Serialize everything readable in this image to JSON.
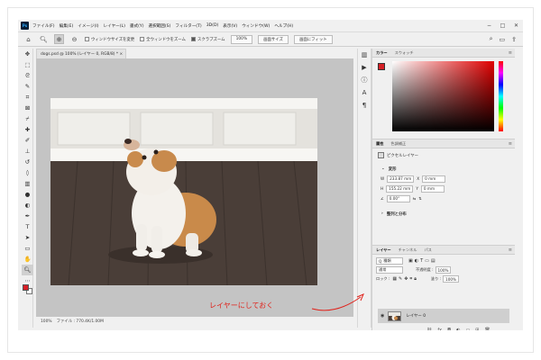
{
  "app": {
    "icon": "Ps"
  },
  "menu": [
    "ファイル(F)",
    "編集(E)",
    "イメージ(I)",
    "レイヤー(L)",
    "書式(Y)",
    "選択範囲(S)",
    "フィルター(T)",
    "3D(D)",
    "表示(V)",
    "ウィンドウ(W)",
    "ヘルプ(H)"
  ],
  "window_controls": [
    "−",
    "□",
    "✕"
  ],
  "options": {
    "check1": "ウィンドウサイズを変更",
    "check2": "全ウィンドウをズーム",
    "check3": "スクラブズーム",
    "zoom_value": "100%",
    "fit_screen": "画面サイズ",
    "fill_screen": "画面にフィット"
  },
  "document": {
    "tab": "dogs.psd @ 100% (レイヤー 0, RGB/8) *  ×",
    "status_zoom": "100%",
    "status_info": "ファイル : 770.4K/1.00M"
  },
  "colors": {
    "foreground": "#d61f26",
    "background": "#ffffff",
    "annotation": "#e0231c"
  },
  "panels": {
    "color_tabs": [
      "カラー",
      "スウォッチ"
    ],
    "props_tabs": [
      "属性",
      "色調補正"
    ],
    "props_layer_type": "ピクセルレイヤー",
    "transform_title": "変形",
    "w": "233.87 mm",
    "h": "155.22 mm",
    "x": "0 mm",
    "y": "0 mm",
    "angle": "0.00°",
    "align_title": "整列と分布",
    "layers_tabs": [
      "レイヤー",
      "チャンネル",
      "パス"
    ],
    "kind": "種類",
    "blend": "通常",
    "opacity_label": "不透明度 :",
    "opacity": "100%",
    "lock_label": "ロック :",
    "fill_label": "塗り :",
    "fill": "100%",
    "layer_name": "レイヤー 0"
  },
  "annotation": {
    "text": "レイヤーにしておく"
  }
}
